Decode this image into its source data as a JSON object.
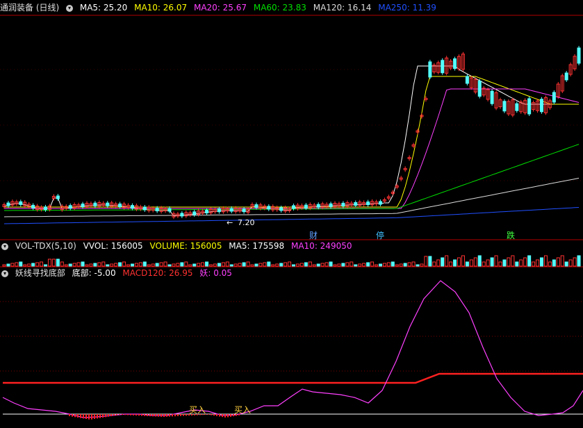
{
  "main_legend": {
    "title": "通润装备 (日线)",
    "items": [
      {
        "label": "MA5: 25.20",
        "color": "#ffffff"
      },
      {
        "label": "MA10: 26.07",
        "color": "#ffff00"
      },
      {
        "label": "MA20: 25.67",
        "color": "#ff40ff"
      },
      {
        "label": "MA60: 23.83",
        "color": "#00e000"
      },
      {
        "label": "MA120: 16.14",
        "color": "#dcdcdc"
      },
      {
        "label": "MA250: 11.39",
        "color": "#2050ff"
      }
    ]
  },
  "vol_legend": {
    "title": "VOL-TDX(5,10)",
    "items": [
      {
        "label": "VVOL: 156005",
        "color": "#ffffff"
      },
      {
        "label": "VOLUME: 156005",
        "color": "#ffff00"
      },
      {
        "label": "MA5: 175598",
        "color": "#ffffff"
      },
      {
        "label": "MA10: 249050",
        "color": "#ff40ff"
      }
    ]
  },
  "ind_legend": {
    "title": "妖线寻找底部",
    "items": [
      {
        "label": "底部: -5.00",
        "color": "#ffffff"
      },
      {
        "label": "MACD120: 26.95",
        "color": "#ff3030"
      },
      {
        "label": "妖: 0.05",
        "color": "#ff40ff"
      }
    ]
  },
  "annotations": {
    "low_price": "7.20",
    "markers": [
      {
        "text": "财",
        "color": "#60a0ff"
      },
      {
        "text": "停",
        "color": "#40c0ff"
      },
      {
        "text": "跌",
        "color": "#40ff40"
      }
    ],
    "buy_labels": [
      "买入",
      "买入"
    ]
  },
  "colors": {
    "up": "#ff3232",
    "down": "#54ffff",
    "border": "#b40000",
    "grid": "#800000"
  },
  "chart_data": [
    {
      "type": "candlestick",
      "name": "price",
      "overlays": [
        "MA5",
        "MA10",
        "MA20",
        "MA60",
        "MA120",
        "MA250"
      ]
    },
    {
      "type": "bar",
      "name": "volume"
    },
    {
      "type": "line",
      "name": "indicator",
      "series": [
        {
          "name": "妖",
          "color": "#ff40ff"
        },
        {
          "name": "MACD120",
          "color": "#ff3030"
        },
        {
          "name": "底部",
          "color": "#ffffff"
        }
      ]
    }
  ]
}
